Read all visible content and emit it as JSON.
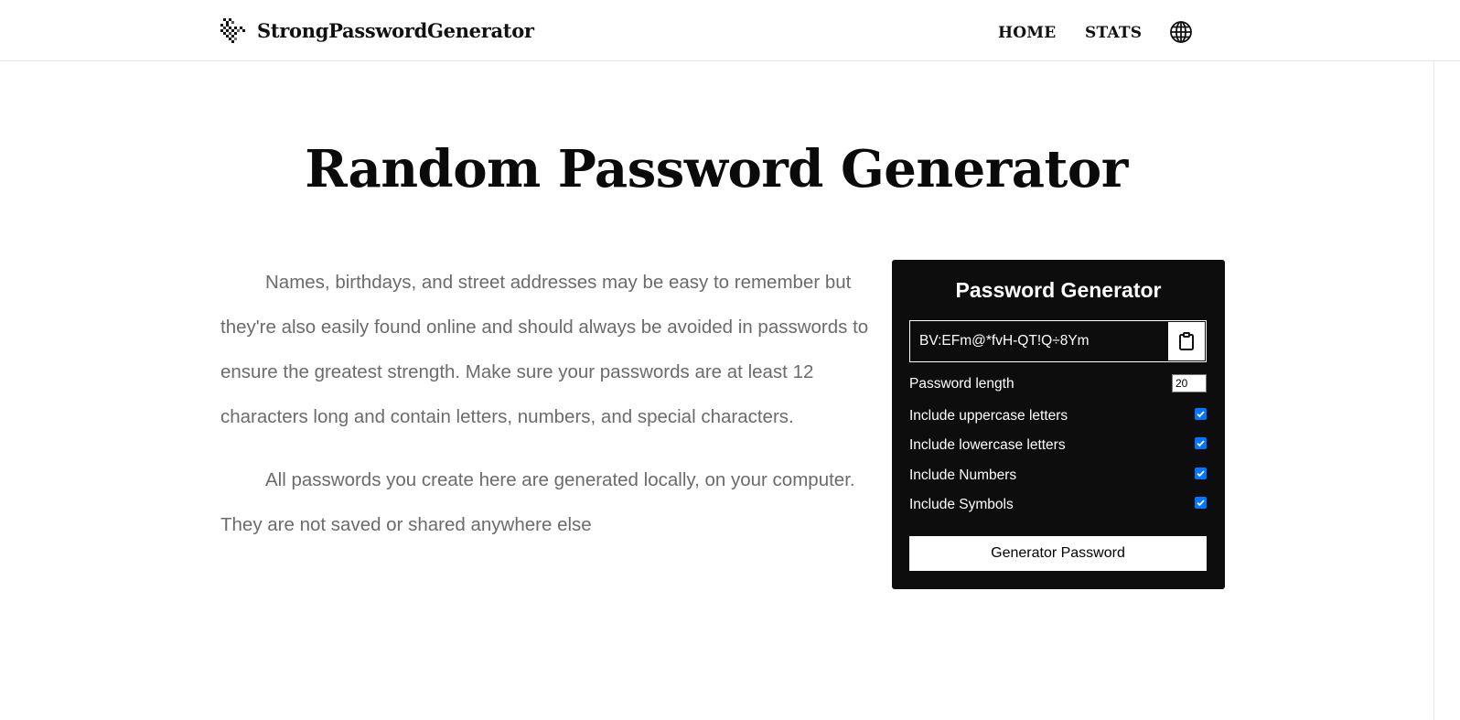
{
  "header": {
    "brand_name": "StrongPasswordGenerator",
    "nav": {
      "home": "HOME",
      "stats": "STATS"
    },
    "language_icon": "globe-icon"
  },
  "main": {
    "title": "Random Password Generator",
    "intro": [
      "Names, birthdays, and street addresses may be easy to remember but they're also easily found online and should always be avoided in passwords to ensure the greatest strength. Make sure your passwords are at least 12 characters long and contain letters, numbers, and special characters.",
      "All passwords you create here are generated locally, on your computer. They are not saved or shared anywhere else"
    ]
  },
  "generator": {
    "title": "Password Generator",
    "result": "BV:EFm@*fvH-QT!Q÷8Ym",
    "copy_icon": "clipboard-icon",
    "length_label": "Password length",
    "length_value": "20",
    "options": [
      {
        "label": "Include uppercase letters",
        "checked": true
      },
      {
        "label": "Include lowercase letters",
        "checked": true
      },
      {
        "label": "Include Numbers",
        "checked": true
      },
      {
        "label": "Include Symbols",
        "checked": true
      }
    ],
    "button_label": "Generator Password"
  },
  "colors": {
    "panel_bg": "#0d0d0d",
    "checkbox_accent": "#0075ff",
    "body_text": "#6b6b6b"
  }
}
